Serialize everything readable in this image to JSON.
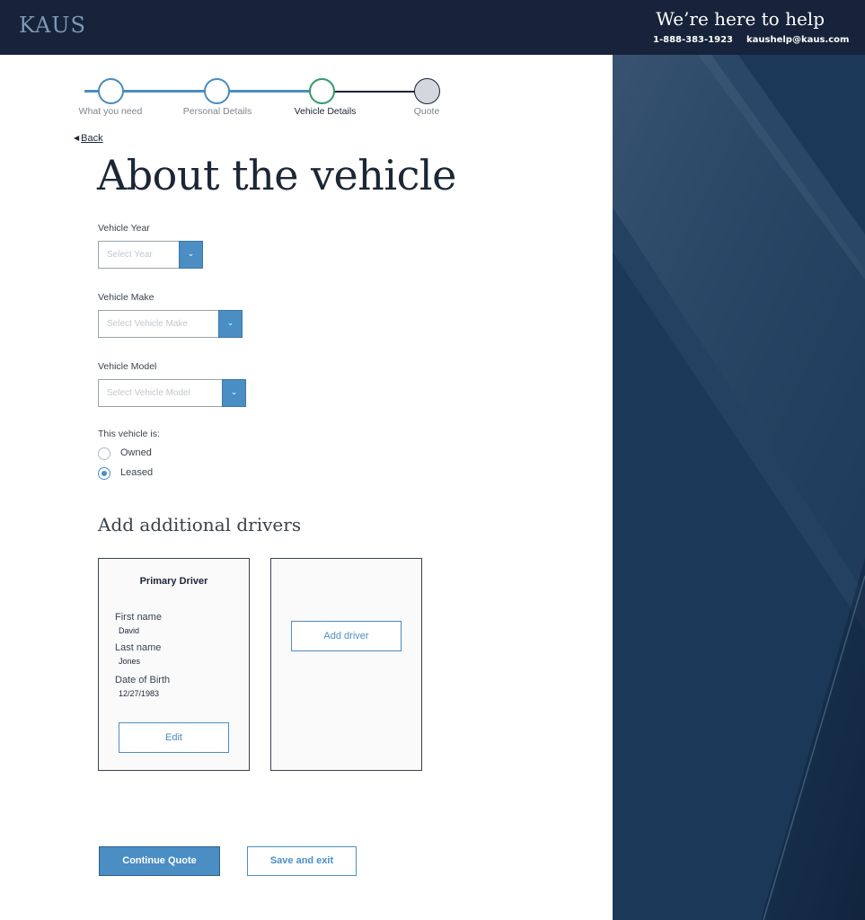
{
  "header": {
    "logo": "KAUS",
    "help_title": "We’re here to help",
    "phone": "1-888-383-1923",
    "email": "kaushelp@kaus.com"
  },
  "stepper": {
    "steps": [
      {
        "label": "What you need",
        "state": "complete"
      },
      {
        "label": "Personal Details",
        "state": "complete"
      },
      {
        "label": "Vehicle Details",
        "state": "current"
      },
      {
        "label": "Quote",
        "state": "upcoming"
      }
    ]
  },
  "back_label": "Back",
  "page_title": "About the vehicle",
  "form": {
    "year_label": "Vehicle Year",
    "year_placeholder": "Select Year",
    "make_label": "Vehicle Make",
    "make_placeholder": "Select Vehicle Make",
    "model_label": "Vehicle Model",
    "model_placeholder": "Select Vehicle Model",
    "ownership_label": "This vehicle is:",
    "ownership_options": [
      {
        "label": "Owned",
        "checked": false
      },
      {
        "label": "Leased",
        "checked": true
      }
    ]
  },
  "drivers": {
    "section_title": "Add additional drivers",
    "primary": {
      "title": "Primary Driver",
      "first_name_label": "First name",
      "first_name": "David",
      "last_name_label": "Last name",
      "last_name": "Jones",
      "dob_label": "Date of Birth",
      "dob": "12/27/1983",
      "edit_label": "Edit"
    },
    "add_driver_label": "Add driver"
  },
  "actions": {
    "continue_label": "Continue Quote",
    "save_label": "Save and exit"
  },
  "colors": {
    "header_bg": "#17233a",
    "accent": "#4b8ec4",
    "current_step": "#2e9b6a",
    "panel": "#1a3657"
  }
}
